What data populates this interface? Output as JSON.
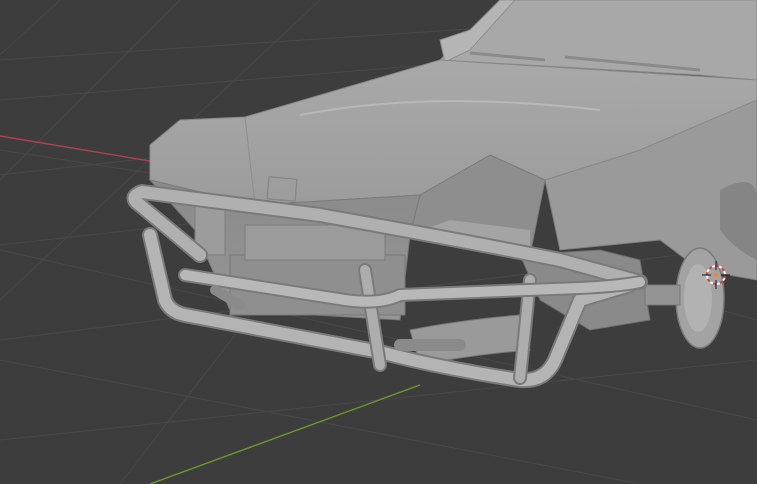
{
  "app": {
    "name": "3D viewport"
  },
  "viewport": {
    "shading": "solid",
    "background_color": "#3d3d3d",
    "grid_line_color": "#4a4a4a",
    "x_axis_color": "#b0414d",
    "y_axis_color": "#6b9a2c",
    "model_base_color": "#a6a6a6",
    "model_shadow_color": "#7c7c7c",
    "model_highlight_color": "#c3c3c3",
    "cursor_colors": [
      "#e23a3a",
      "#ffffff"
    ]
  },
  "scene": {
    "objects": [
      {
        "name": "car-body",
        "type": "mesh"
      },
      {
        "name": "bull-bar",
        "type": "mesh"
      },
      {
        "name": "headlight",
        "type": "mesh"
      }
    ],
    "has_3d_cursor": true
  }
}
